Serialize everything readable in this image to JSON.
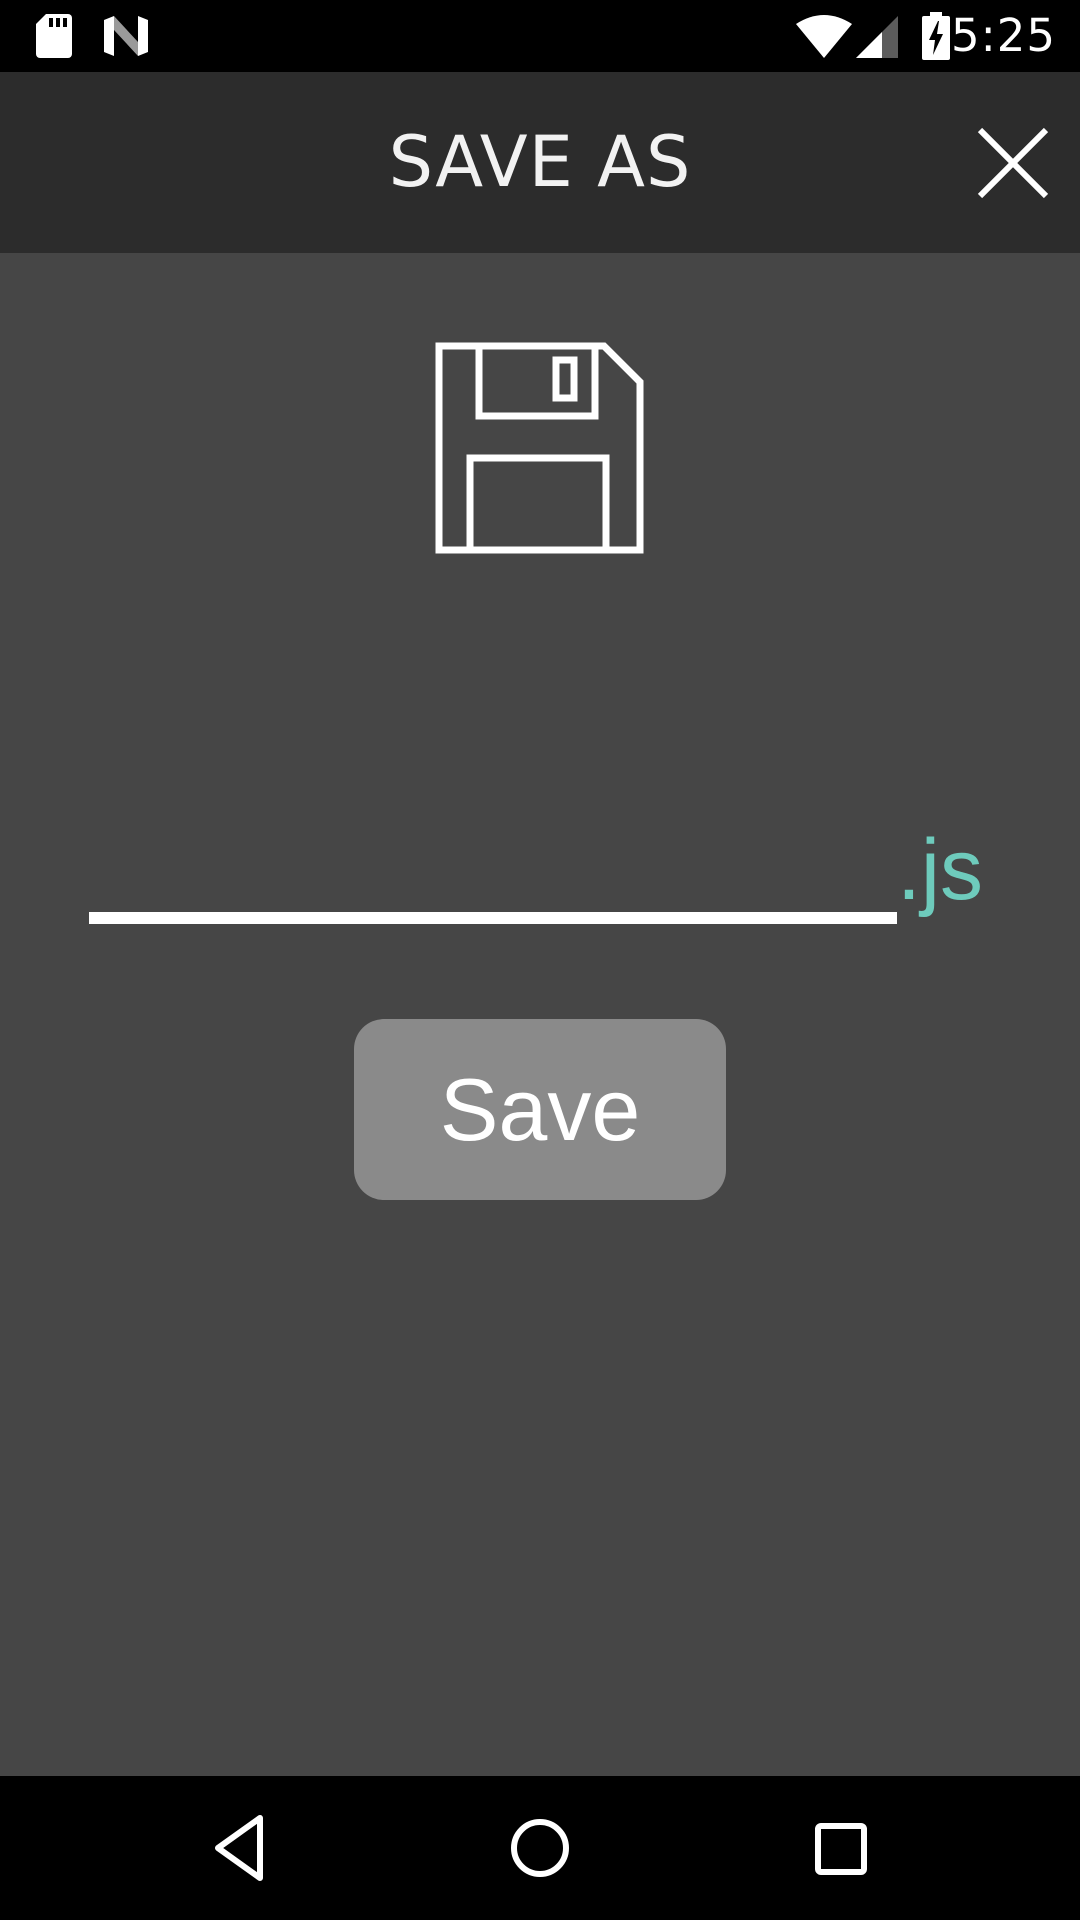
{
  "status_bar": {
    "time": "5:25",
    "icons": [
      "sd-card-icon",
      "n-logo-icon",
      "wifi-icon",
      "cell-signal-icon",
      "battery-charging-icon"
    ]
  },
  "title_bar": {
    "title": "SAVE AS",
    "close_icon": "close-icon"
  },
  "main": {
    "icon": "floppy-disk-icon",
    "filename": {
      "value": "",
      "placeholder": ""
    },
    "extension": ".js",
    "save_label": "Save"
  },
  "nav_bar": {
    "buttons": [
      "back-icon",
      "home-icon",
      "recents-icon"
    ]
  },
  "colors": {
    "background": "#464646",
    "title_bar": "#2c2c2c",
    "accent": "#6ecbbc",
    "button": "#8a8a8a"
  }
}
